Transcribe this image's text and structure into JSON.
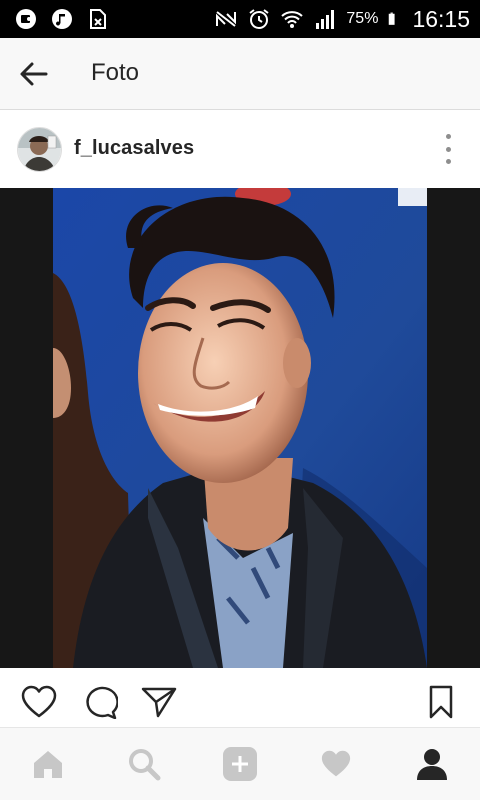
{
  "status_bar": {
    "battery_percent": "75%",
    "time": "16:15",
    "left_icons": [
      "messenger-icon",
      "music-icon",
      "sim-disabled-icon"
    ],
    "right_icons": [
      "nfc-icon",
      "alarm-icon",
      "wifi-icon",
      "signal-icon",
      "battery-icon"
    ]
  },
  "app_bar": {
    "title": "Foto",
    "back_icon": "arrow-left-icon"
  },
  "post": {
    "username": "f_lucasalves",
    "menu_icon": "more-vertical-icon",
    "photo_icon": "selfie-photo",
    "actions": [
      "heart-icon",
      "comment-icon",
      "send-icon",
      "bookmark-icon"
    ]
  },
  "bottom_nav": {
    "items": [
      "home-icon",
      "search-icon",
      "add-post-icon",
      "activity-heart-icon",
      "profile-icon"
    ],
    "active": "profile-icon"
  },
  "colors": {
    "text": "#262626",
    "icon_gray": "#c7c7c7",
    "icon_active": "#262626",
    "status_bar": "#000000",
    "photo_letterbox": "#171717",
    "photo_background_blue": "#1f4a9a"
  }
}
